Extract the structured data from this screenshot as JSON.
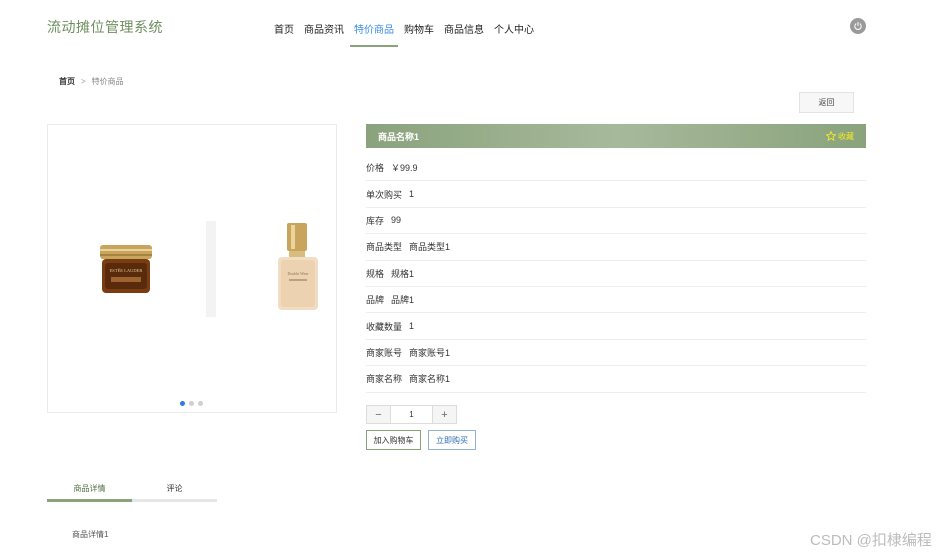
{
  "header": {
    "brand": "流动摊位管理系统",
    "nav": [
      {
        "label": "首页",
        "active": false
      },
      {
        "label": "商品资讯",
        "active": false
      },
      {
        "label": "特价商品",
        "active": true
      },
      {
        "label": "购物车",
        "active": false
      },
      {
        "label": "商品信息",
        "active": false
      },
      {
        "label": "个人中心",
        "active": false
      }
    ],
    "power_icon": "power-icon"
  },
  "breadcrumb": {
    "home": "首页",
    "separator": ">",
    "current": "特价商品"
  },
  "back_label": "返回",
  "product": {
    "title": "商品名称1",
    "favorite_label": "收藏",
    "favorite_icon": "star-outline-icon",
    "fields": [
      {
        "label": "价格",
        "value": "￥99.9"
      },
      {
        "label": "单次购买",
        "value": "1"
      },
      {
        "label": "库存",
        "value": "99"
      },
      {
        "label": "商品类型",
        "value": "商品类型1"
      },
      {
        "label": "规格",
        "value": "规格1"
      },
      {
        "label": "品牌",
        "value": "品牌1"
      },
      {
        "label": "收藏数量",
        "value": "1"
      },
      {
        "label": "商家账号",
        "value": "商家账号1"
      },
      {
        "label": "商家名称",
        "value": "商家名称1"
      }
    ]
  },
  "carousel": {
    "slide_count": 3,
    "active_index": 0
  },
  "quantity": {
    "minus": "−",
    "value": "1",
    "plus": "+"
  },
  "actions": {
    "add_to_cart": "加入购物车",
    "buy_now": "立即购买"
  },
  "tabs": [
    {
      "label": "商品详情",
      "active": true
    },
    {
      "label": "评论",
      "active": false
    }
  ],
  "detail_text": "商品详情1",
  "watermark": "CSDN @扣棣编程",
  "colors": {
    "accent": "#8aa37c",
    "link": "#3a8ee6",
    "star": "#f2ea2a",
    "dot_active": "#2f7be0"
  }
}
